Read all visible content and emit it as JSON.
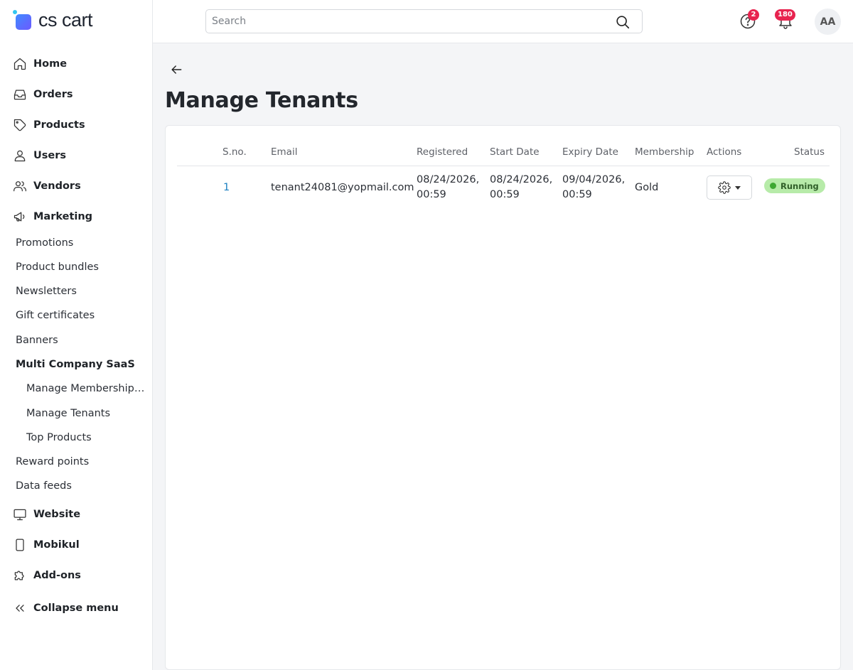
{
  "app": {
    "logo_text": "cs cart"
  },
  "header": {
    "search_placeholder": "Search",
    "help_badge": "2",
    "notifications_badge": "180",
    "avatar_initials": "AA"
  },
  "sidebar": {
    "items": [
      {
        "label": "Home",
        "icon": "home-icon"
      },
      {
        "label": "Orders",
        "icon": "inbox-icon"
      },
      {
        "label": "Products",
        "icon": "tag-icon"
      },
      {
        "label": "Users",
        "icon": "user-icon"
      },
      {
        "label": "Vendors",
        "icon": "users-icon"
      },
      {
        "label": "Marketing",
        "icon": "megaphone-icon"
      }
    ],
    "marketing_sub": [
      "Promotions",
      "Product bundles",
      "Newsletters",
      "Gift certificates",
      "Banners",
      "Multi Company SaaS"
    ],
    "saas_sub": [
      "Manage Membership Plans",
      "Manage Tenants",
      "Top Products"
    ],
    "marketing_sub_after": [
      "Reward points",
      "Data feeds"
    ],
    "items_after": [
      {
        "label": "Website",
        "icon": "monitor-icon"
      },
      {
        "label": "Mobikul",
        "icon": "smartphone-icon"
      },
      {
        "label": "Add-ons",
        "icon": "puzzle-icon"
      }
    ],
    "collapse_label": "Collapse menu"
  },
  "page": {
    "title": "Manage Tenants"
  },
  "table": {
    "columns": [
      "S.no.",
      "Email",
      "Registered",
      "Start Date",
      "Expiry Date",
      "Membership",
      "Actions",
      "Status"
    ],
    "rows": [
      {
        "sno": "1",
        "email": "tenant24081@yopmail.com",
        "registered_date": "08/24/2026,",
        "registered_time": "00:59",
        "start_date": "08/24/2026,",
        "start_time": "00:59",
        "expiry_date": "09/04/2026,",
        "expiry_time": "00:59",
        "membership": "Gold",
        "status": "Running"
      }
    ]
  },
  "colors": {
    "accent": "#1a7fc1",
    "badge": "#e8234f",
    "status_running_bg": "#b7eba9",
    "status_running_dot": "#3fa833"
  }
}
